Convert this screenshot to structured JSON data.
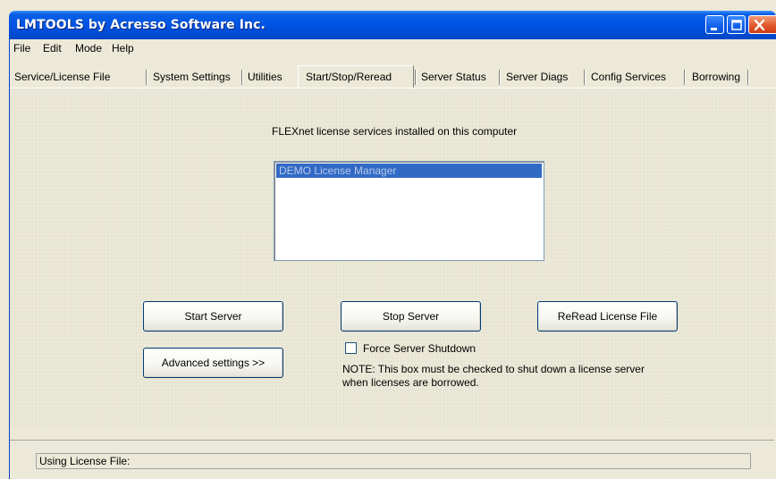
{
  "window": {
    "title": "LMTOOLS by Acresso Software Inc."
  },
  "menu": [
    "File",
    "Edit",
    "Mode",
    "Help"
  ],
  "tabs": [
    "Service/License File",
    "System Settings",
    "Utilities",
    "Start/Stop/Reread",
    "Server Status",
    "Server Diags",
    "Config Services",
    "Borrowing"
  ],
  "active_tab": "Start/Stop/Reread",
  "main": {
    "services_label": "FLEXnet license services installed on this computer",
    "services": [
      "DEMO License Manager"
    ],
    "start_button": "Start Server",
    "stop_button": "Stop Server",
    "reread_button": "ReRead License File",
    "advanced_button": "Advanced settings >>",
    "force_shutdown_label": "Force Server Shutdown",
    "force_shutdown_checked": false,
    "note_line1": "NOTE:  This box must be checked to shut down a license server",
    "note_line2": "when licenses are borrowed."
  },
  "status": {
    "text": "Using License File:"
  },
  "icons": {
    "minimize": "minimize-icon",
    "maximize": "maximize-icon",
    "close": "close-icon"
  }
}
